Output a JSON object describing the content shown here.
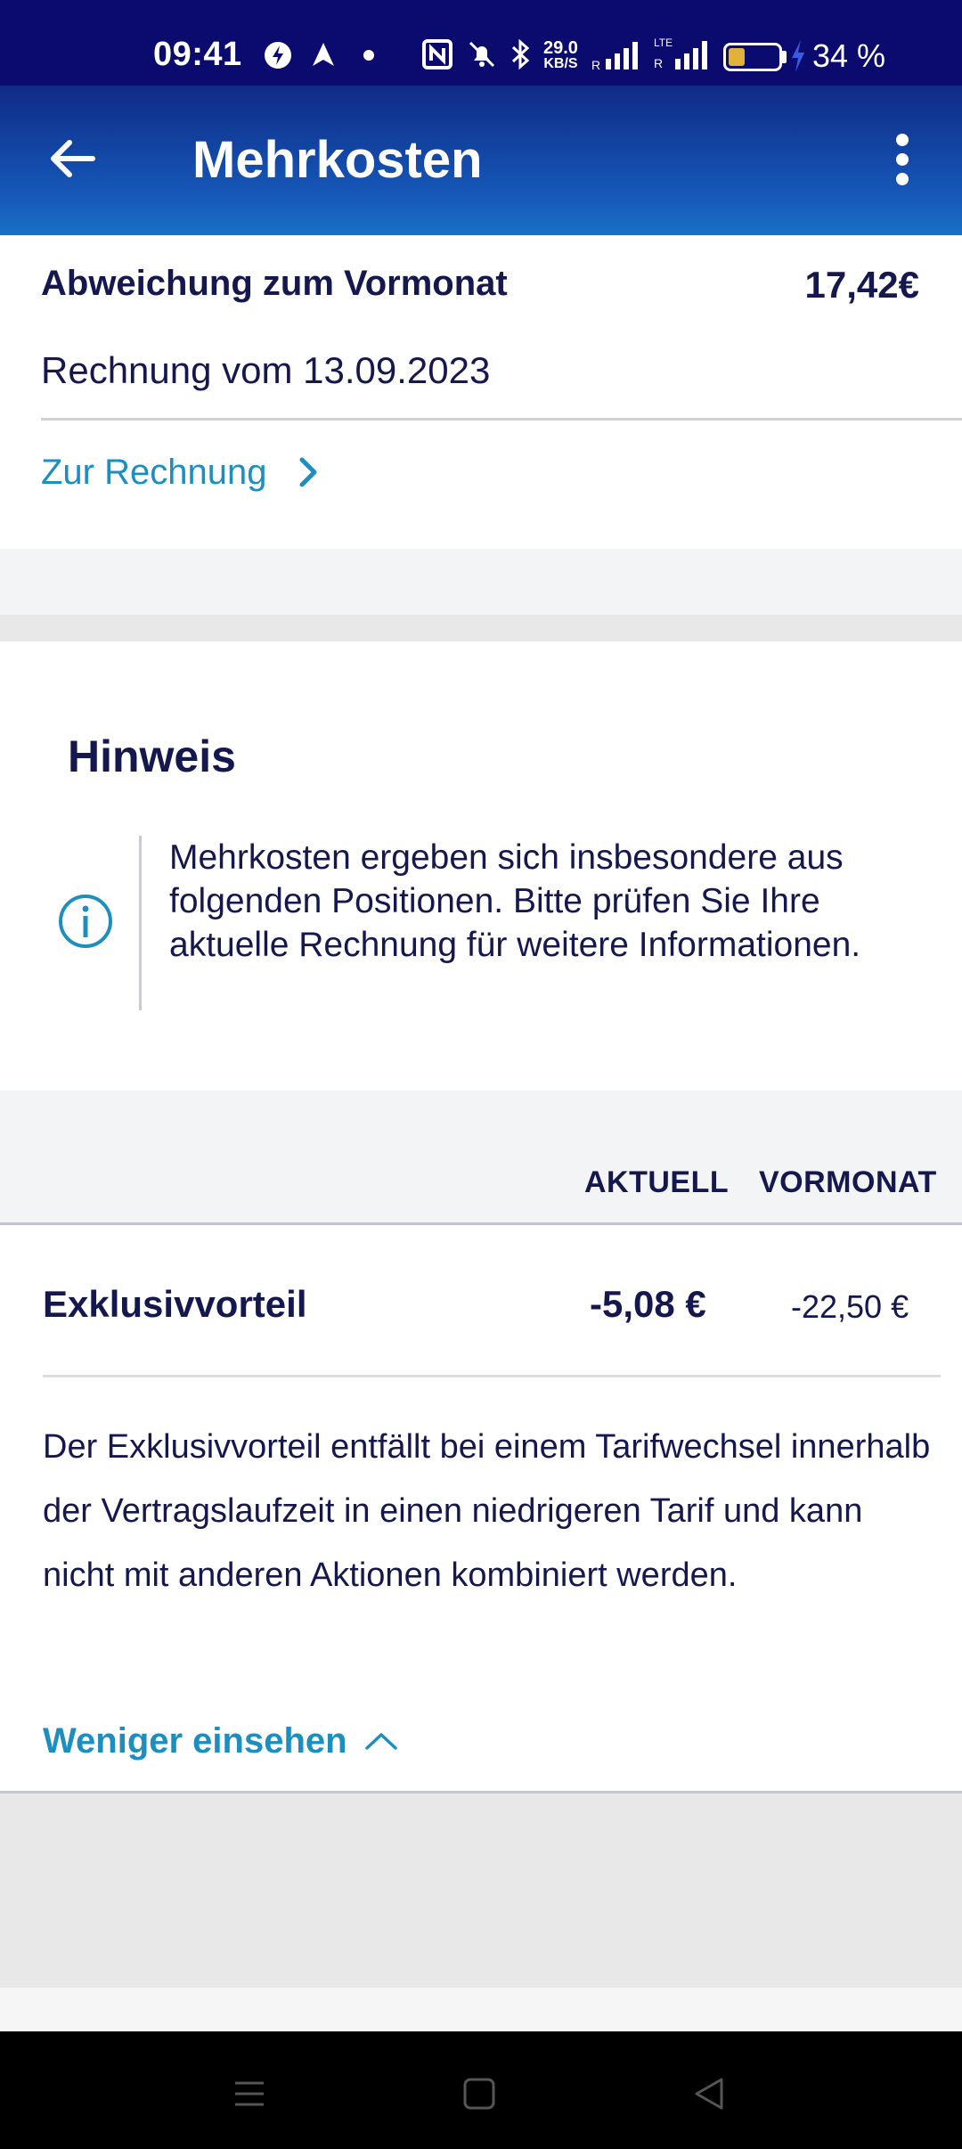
{
  "status_bar": {
    "time": "09:41",
    "net_speed": "29.0",
    "net_unit": "KB/S",
    "battery_percent": "34 %",
    "battery_level": 0.34
  },
  "app_bar": {
    "title": "Mehrkosten",
    "back_icon": "arrow-left-icon",
    "menu_icon": "more-vert-icon"
  },
  "summary": {
    "label": "Abweichung zum Vormonat",
    "value": "17,42€",
    "invoice_date": "Rechnung vom 13.09.2023",
    "link_label": "Zur Rechnung"
  },
  "hinweis": {
    "title": "Hinweis",
    "text": "Mehrkosten ergeben sich insbesondere aus folgenden Positionen. Bitte prüfen Sie Ihre aktuelle Rechnung für weitere Informationen."
  },
  "table": {
    "col_current": "AKTUELL",
    "col_previous": "VORMONAT",
    "rows": [
      {
        "label": "Exklusivvorteil",
        "current": "-5,08 €",
        "previous": "-22,50 €",
        "description": "Der Exklusivvorteil entfällt bei einem Tarifwechsel innerhalb der Vertragslaufzeit in einen niedrigeren Tarif und kann nicht mit anderen Aktionen kombiniert werden.",
        "toggle_label": "Weniger einsehen"
      }
    ]
  },
  "colors": {
    "status_bar": "#0b0a6e",
    "app_bar_top": "#0f2a86",
    "app_bar_bottom": "#1a6fc6",
    "link": "#1c8ec0",
    "text_primary": "#15184f"
  }
}
